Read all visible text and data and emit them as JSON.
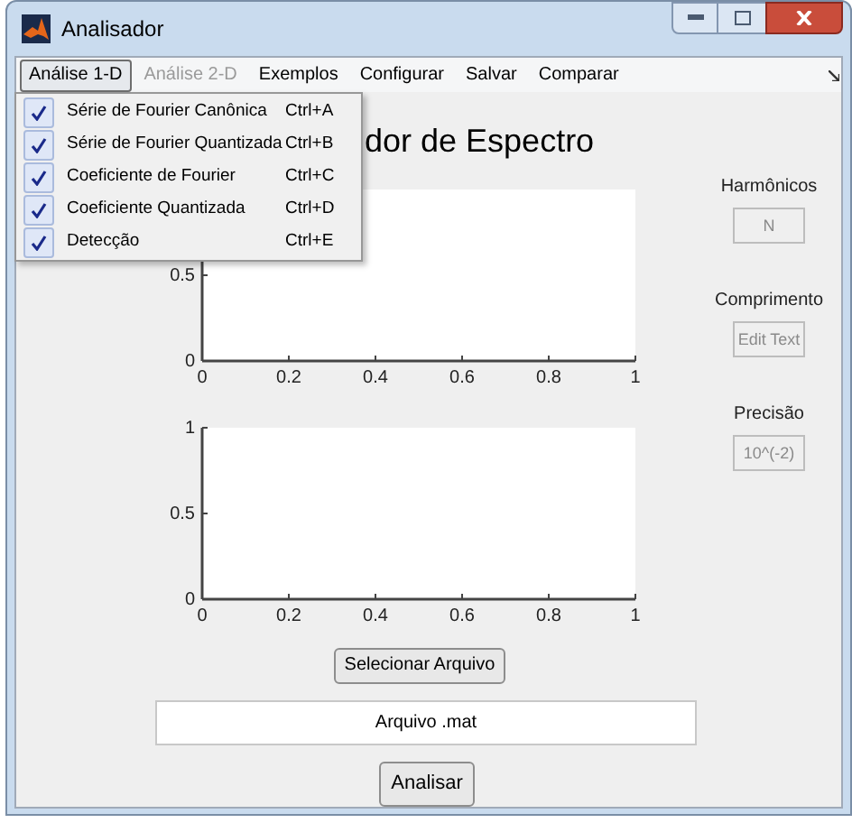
{
  "window": {
    "title": "Analisador"
  },
  "menu_bar": [
    {
      "label": "Análise 1-D",
      "selected": true,
      "disabled": false
    },
    {
      "label": "Análise 2-D",
      "selected": false,
      "disabled": true
    },
    {
      "label": "Exemplos",
      "selected": false,
      "disabled": false
    },
    {
      "label": "Configurar",
      "selected": false,
      "disabled": false
    },
    {
      "label": "Salvar",
      "selected": false,
      "disabled": false
    },
    {
      "label": "Comparar",
      "selected": false,
      "disabled": false
    }
  ],
  "dropdown_menu": [
    {
      "label": "Série de Fourier Canônica",
      "shortcut": "Ctrl+A",
      "checked": true
    },
    {
      "label": "Série de Fourier Quantizada",
      "shortcut": "Ctrl+B",
      "checked": true
    },
    {
      "label": "Coeficiente de Fourier",
      "shortcut": "Ctrl+C",
      "checked": true
    },
    {
      "label": "Coeficiente Quantizada",
      "shortcut": "Ctrl+D",
      "checked": true
    },
    {
      "label": "Detecção",
      "shortcut": "Ctrl+E",
      "checked": true
    }
  ],
  "heading": "dor de Espectro",
  "plots": [
    {
      "chart_data": {
        "type": "line",
        "xlim": [
          0,
          1
        ],
        "ylim": [
          0,
          1
        ],
        "xticks": [
          {
            "value": 0,
            "label": "0"
          },
          {
            "value": 0.2,
            "label": "0.2"
          },
          {
            "value": 0.4,
            "label": "0.4"
          },
          {
            "value": 0.6,
            "label": "0.6"
          },
          {
            "value": 0.8,
            "label": "0.8"
          },
          {
            "value": 1,
            "label": "1"
          }
        ],
        "yticks": [
          {
            "value": 0,
            "label": "0"
          },
          {
            "value": 0.5,
            "label": "0.5"
          }
        ]
      }
    },
    {
      "chart_data": {
        "type": "line",
        "xlim": [
          0,
          1
        ],
        "ylim": [
          0,
          1
        ],
        "xticks": [
          {
            "value": 0,
            "label": "0"
          },
          {
            "value": 0.2,
            "label": "0.2"
          },
          {
            "value": 0.4,
            "label": "0.4"
          },
          {
            "value": 0.6,
            "label": "0.6"
          },
          {
            "value": 0.8,
            "label": "0.8"
          },
          {
            "value": 1,
            "label": "1"
          }
        ],
        "yticks": [
          {
            "value": 0,
            "label": "0"
          },
          {
            "value": 0.5,
            "label": "0.5"
          },
          {
            "value": 1,
            "label": "1"
          }
        ]
      }
    }
  ],
  "select_button": "Selecionar Arquivo",
  "file_field": {
    "value": "Arquivo .mat"
  },
  "analyze_button": "Analisar",
  "parameters": [
    {
      "label": "Harmônicos",
      "value": "N",
      "disabled": true
    },
    {
      "label": "Comprimento",
      "value": "Edit Text",
      "disabled": true
    },
    {
      "label": "Precisão",
      "value": "10^(-2)",
      "disabled": true
    }
  ]
}
